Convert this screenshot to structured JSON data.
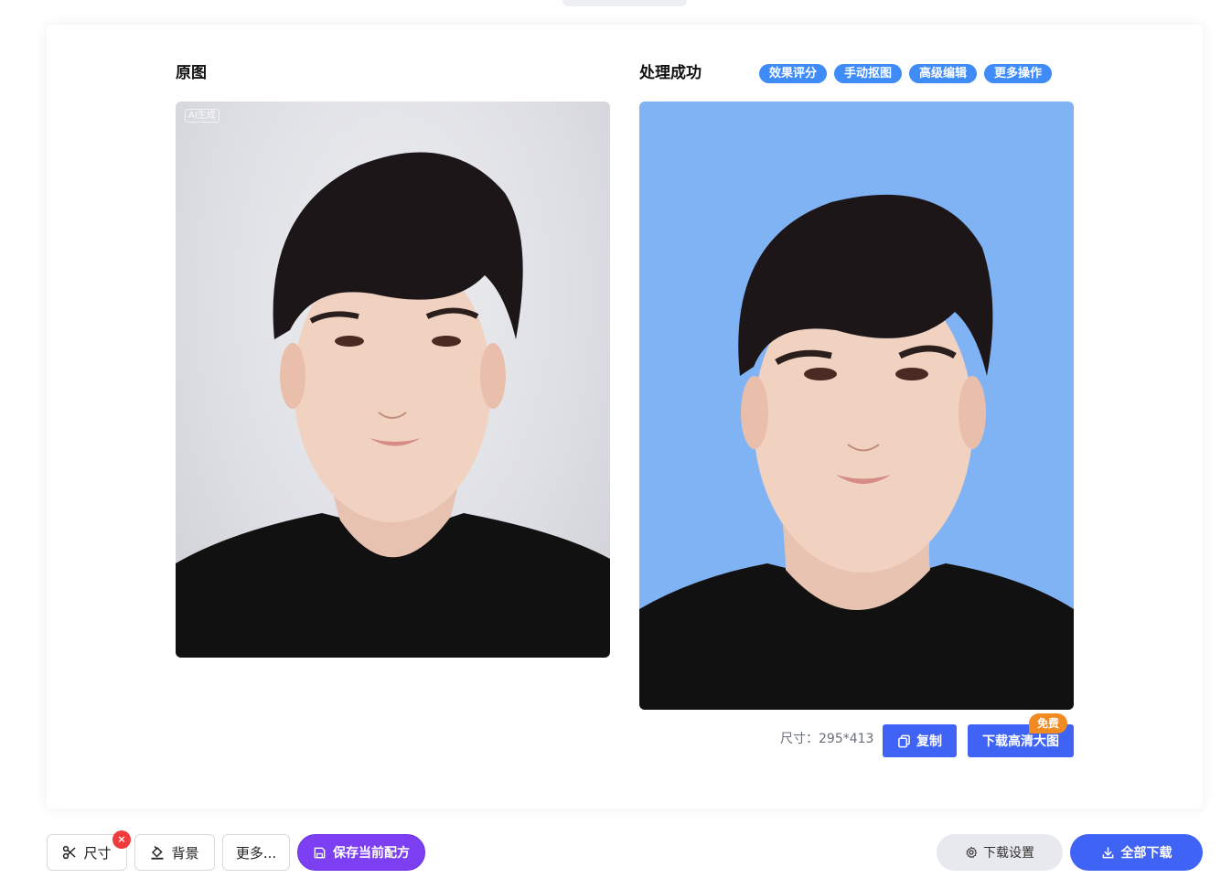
{
  "left_panel": {
    "title": "原图",
    "ai_badge": "AI生成"
  },
  "right_panel": {
    "title": "处理成功",
    "tags": [
      "效果评分",
      "手动抠图",
      "高级编辑",
      "更多操作"
    ]
  },
  "result_info": {
    "size_label": "尺寸：",
    "size_value": "295*413",
    "copy_label": "复制",
    "download_hd_label": "下载高清大图",
    "free_badge": "免费"
  },
  "toolbar": {
    "size_label": "尺寸",
    "remove_label": "×",
    "background_label": "背景",
    "more_label": "更多...",
    "save_recipe_label": "保存当前配方",
    "download_settings_label": "下载设置",
    "download_all_label": "全部下载"
  },
  "colors": {
    "accent": "#3e63f5",
    "tag_blue": "#3f8bf7",
    "purple": "#7c3ff2",
    "badge_orange": "#f28a22",
    "result_background": "#80b3f3",
    "remove_red": "#ef3b3b"
  },
  "icons": {
    "size": "scissors-icon",
    "background": "paint-bucket-icon",
    "save": "save-icon",
    "copy": "copy-icon",
    "download_settings": "gear-icon",
    "download_all": "download-icon"
  }
}
